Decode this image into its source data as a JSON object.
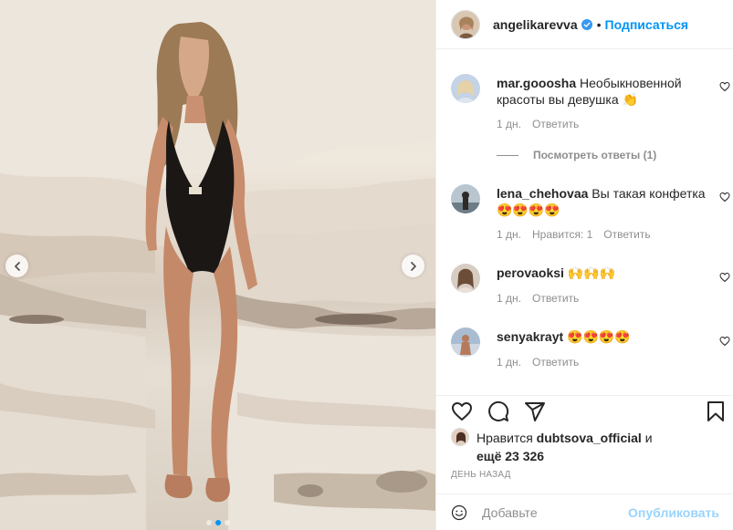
{
  "post": {
    "username": "angelikarevva",
    "separator": "•",
    "follow_label": "Подписаться",
    "carousel": {
      "slide_count": 3,
      "active_index": 1
    }
  },
  "comments": [
    {
      "username": "mar.gooosha",
      "text": "Необыкновенной красоты вы девушка 👏",
      "time": "1 дн.",
      "likes": "",
      "reply_label": "Ответить",
      "view_replies": "Посмотреть ответы (1)"
    },
    {
      "username": "lena_chehovaa",
      "text": "Вы такая конфетка 😍😍😍😍",
      "time": "1 дн.",
      "likes": "Нравится: 1",
      "reply_label": "Ответить"
    },
    {
      "username": "perovaoksi",
      "text": "🙌🙌🙌",
      "time": "1 дн.",
      "likes": "",
      "reply_label": "Ответить"
    },
    {
      "username": "senyakrayt",
      "text": "😍😍😍😍",
      "time": "1 дн.",
      "likes": "",
      "reply_label": "Ответить"
    }
  ],
  "likes": {
    "prefix": "Нравится",
    "user": "dubtsova_official",
    "conj": "и",
    "rest": "ещё 23 326"
  },
  "date": "ДЕНЬ НАЗАД",
  "add_comment": {
    "placeholder": "Добавьте",
    "publish_label": "Опубликовать"
  },
  "colors": {
    "accent": "#0095f6",
    "muted": "#8e8e8e",
    "text": "#262626",
    "divider": "#efefef"
  },
  "icons": [
    "chevron-left-icon",
    "chevron-right-icon",
    "verified-badge-icon",
    "heart-icon",
    "comment-icon",
    "share-icon",
    "bookmark-icon",
    "smile-icon"
  ]
}
